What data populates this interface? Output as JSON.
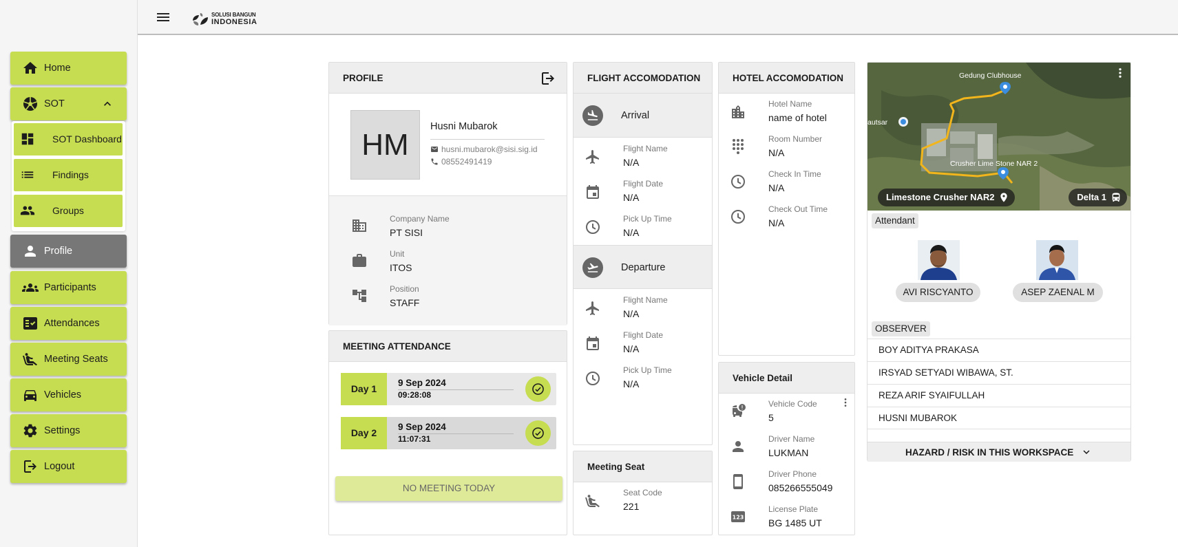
{
  "brand": {
    "line1": "SOLUSI BANGUN",
    "line2": "INDONESIA"
  },
  "sidebar": {
    "home": "Home",
    "sot": "SOT",
    "sot_sub": [
      "SOT Dashboard",
      "Findings",
      "Groups"
    ],
    "profile": "Profile",
    "participants": "Participants",
    "attendances": "Attendances",
    "meeting_seats": "Meeting Seats",
    "vehicles": "Vehicles",
    "settings": "Settings",
    "logout": "Logout"
  },
  "profile": {
    "title": "PROFILE",
    "initials": "HM",
    "name": "Husni Mubarok",
    "email": "husni.mubarok@sisi.sig.id",
    "phone": "08552491419",
    "company_label": "Company Name",
    "company": "PT SISI",
    "unit_label": "Unit",
    "unit": "ITOS",
    "position_label": "Position",
    "position": "STAFF"
  },
  "attendance": {
    "title": "MEETING ATTENDANCE",
    "days": [
      {
        "label": "Day 1",
        "date": "9 Sep 2024",
        "time": "09:28:08"
      },
      {
        "label": "Day 2",
        "date": "9 Sep 2024",
        "time": "11:07:31"
      }
    ],
    "no_meeting": "NO MEETING TODAY"
  },
  "flight": {
    "title": "FLIGHT ACCOMODATION",
    "arrival": "Arrival",
    "departure": "Departure",
    "name_label": "Flight Name",
    "date_label": "Flight Date",
    "pickup_label": "Pick Up Time",
    "arrival_values": {
      "name": "N/A",
      "date": "N/A",
      "pickup": "N/A"
    },
    "departure_values": {
      "name": "N/A",
      "date": "N/A",
      "pickup": "N/A"
    }
  },
  "seat": {
    "title": "Meeting Seat",
    "code_label": "Seat Code",
    "code": "221"
  },
  "hotel": {
    "title": "HOTEL ACCOMODATION",
    "name_label": "Hotel Name",
    "name": "name of hotel",
    "room_label": "Room Number",
    "room": "N/A",
    "checkin_label": "Check In Time",
    "checkin": "N/A",
    "checkout_label": "Check Out Time",
    "checkout": "N/A"
  },
  "vehicle": {
    "title": "Vehicle Detail",
    "code_label": "Vehicle Code",
    "code": "5",
    "driver_label": "Driver Name",
    "driver": "LUKMAN",
    "phone_label": "Driver Phone",
    "phone": "085266555049",
    "plate_label": "License Plate",
    "plate": "BG 1485 UT"
  },
  "workspace": {
    "map_labels": {
      "clubhouse": "Gedung Clubhouse",
      "crusher": "Crusher Lime Stone NAR 2",
      "left": "autsar"
    },
    "location": "Limestone Crusher NAR2",
    "bus": "Delta 1",
    "attendant_label": "Attendant",
    "attendants": [
      "AVI RISCYANTO",
      "ASEP ZAENAL M"
    ],
    "observer_label": "OBSERVER",
    "observers": [
      "BOY ADITYA PRAKASA",
      "IRSYAD SETYADI WIBAWA, ST.",
      "REZA ARIF SYAIFULLAH",
      "HUSNI MUBAROK"
    ],
    "hazard": "HAZARD / RISK IN THIS WORKSPACE"
  },
  "colors": {
    "accent": "#c6dd52",
    "active_nav": "#777777",
    "map_route": "#f2b51c"
  }
}
